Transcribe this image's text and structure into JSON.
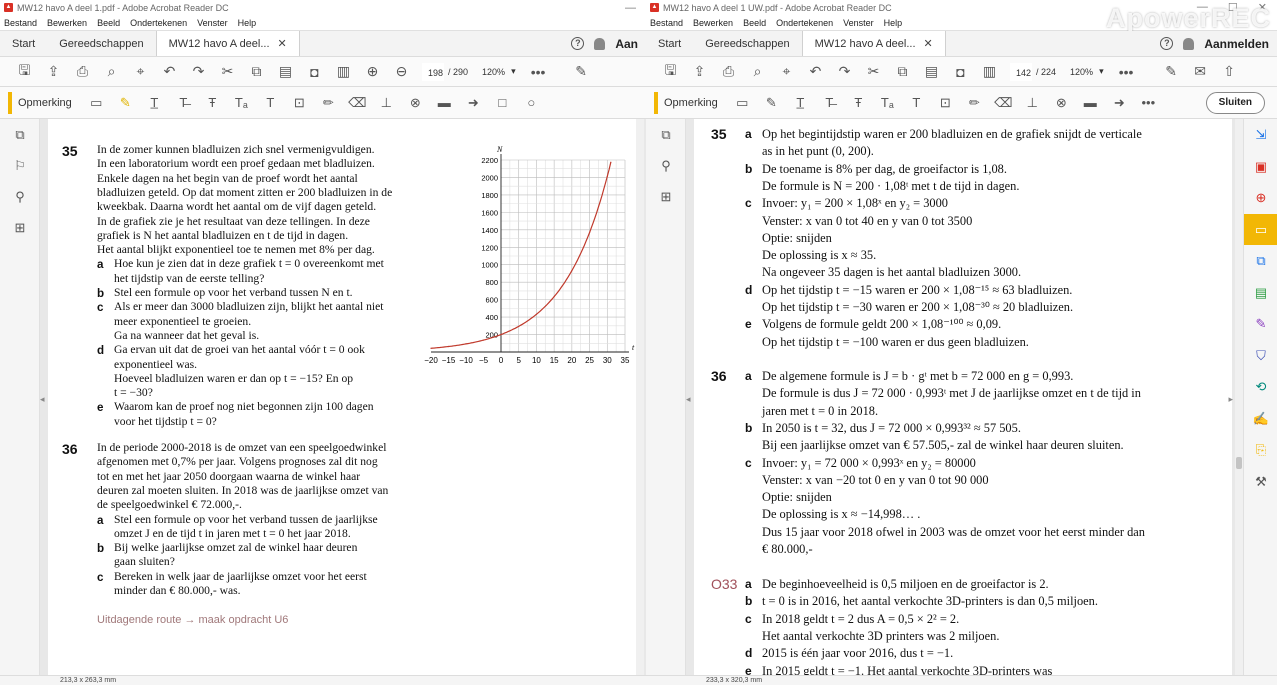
{
  "watermark": "ApowerREC",
  "left_window": {
    "title": "MW12 havo A deel 1.pdf - Adobe Acrobat Reader DC",
    "menu": [
      "Bestand",
      "Bewerken",
      "Beeld",
      "Ondertekenen",
      "Venster",
      "Help"
    ],
    "tabs": [
      "Start",
      "Gereedschappen",
      "MW12 havo A deel..."
    ],
    "signin_partial": "Aan",
    "page_current": "198",
    "page_total": "/ 290",
    "zoom": "120%",
    "comment_label": "Opmerking",
    "status": "213,3 x 263,3 mm",
    "ex35": {
      "num": "35",
      "intro": [
        "In de zomer kunnen bladluizen zich snel vermenigvuldigen.",
        "In een laboratorium wordt een proef gedaan met bladluizen.",
        "Enkele dagen na het begin van de proef wordt het aantal",
        "bladluizen geteld. Op dat moment zitten er 200 bladluizen in de",
        "kweekbak. Daarna wordt het aantal om de vijf dagen geteld.",
        "In de grafiek zie je het resultaat van deze tellingen. In deze",
        "grafiek is N het aantal bladluizen en t de tijd in dagen.",
        "Het aantal blijkt exponentieel toe te nemen met 8% per dag."
      ],
      "items": [
        {
          "label": "a",
          "lines": [
            "Hoe kun je zien dat in deze grafiek t = 0 overeenkomt met",
            "het tijdstip van de eerste telling?"
          ]
        },
        {
          "label": "b",
          "lines": [
            "Stel een formule op voor het verband tussen N en t."
          ]
        },
        {
          "label": "c",
          "lines": [
            "Als er meer dan 3000 bladluizen zijn, blijkt het aantal niet",
            "meer exponentieel te groeien.",
            "Ga na wanneer dat het geval is."
          ]
        },
        {
          "label": "d",
          "lines": [
            "Ga ervan uit dat de groei van het aantal vóór t = 0 ook",
            "exponentieel was.",
            "Hoeveel bladluizen waren er dan op t = −15? En op",
            "t = −30?"
          ]
        },
        {
          "label": "e",
          "lines": [
            "Waarom kan de proef nog niet begonnen zijn 100 dagen",
            "voor het tijdstip t = 0?"
          ]
        }
      ]
    },
    "ex36": {
      "num": "36",
      "intro": [
        "In de periode 2000-2018 is de omzet van een speelgoedwinkel",
        "afgenomen met 0,7% per jaar. Volgens prognoses zal dit nog",
        "tot en met het jaar 2050 doorgaan waarna de winkel haar",
        "deuren zal moeten sluiten. In 2018 was de jaarlijkse omzet van",
        "de speelgoedwinkel € 72.000,-."
      ],
      "items": [
        {
          "label": "a",
          "lines": [
            "Stel een formule op voor het verband tussen de jaarlijkse",
            "omzet J en de tijd t in jaren met t = 0 het jaar 2018."
          ]
        },
        {
          "label": "b",
          "lines": [
            "Bij welke jaarlijkse omzet zal de winkel haar deuren",
            "gaan sluiten?"
          ]
        },
        {
          "label": "c",
          "lines": [
            "Bereken in welk jaar de jaarlijkse omzet voor het eerst",
            "minder dan € 80.000,- was."
          ]
        }
      ]
    },
    "route": "Uitdagende route → maak opdracht U6"
  },
  "chart_data": {
    "type": "line",
    "title": "",
    "xlabel": "t",
    "ylabel": "N",
    "xlim": [
      -20,
      35
    ],
    "ylim": [
      0,
      2200
    ],
    "x_ticks": [
      "−20",
      "−15",
      "−10",
      "−5",
      "0",
      "5",
      "10",
      "15",
      "20",
      "25",
      "30",
      "35"
    ],
    "y_ticks": [
      "200",
      "400",
      "600",
      "800",
      "1000",
      "1200",
      "1400",
      "1600",
      "1800",
      "2000",
      "2200"
    ],
    "grid": true,
    "series": [
      {
        "color": "#c0392b",
        "x": [
          -20,
          -15,
          -10,
          -5,
          0,
          5,
          10,
          15,
          20,
          25,
          30,
          31
        ],
        "y": [
          43,
          63,
          93,
          136,
          200,
          294,
          432,
          634,
          932,
          1370,
          2013,
          2174
        ]
      }
    ]
  },
  "right_window": {
    "title": "MW12 havo A deel 1 UW.pdf - Adobe Acrobat Reader DC",
    "menu": [
      "Bestand",
      "Bewerken",
      "Beeld",
      "Ondertekenen",
      "Venster",
      "Help"
    ],
    "tabs": [
      "Start",
      "Gereedschappen",
      "MW12 havo A deel..."
    ],
    "signin": "Aanmelden",
    "page_current": "142",
    "page_total": "/ 224",
    "zoom": "120%",
    "comment_label": "Opmerking",
    "close_button": "Sluiten",
    "status": "233,3 x 320,3 mm",
    "answers": [
      {
        "num": "35",
        "items": [
          {
            "label": "a",
            "lines": [
              "Op het begintijdstip waren er 200 bladluizen en de grafiek snijdt de verticale",
              "as in het punt (0, 200)."
            ]
          },
          {
            "label": "b",
            "lines": [
              "De toename is 8% per dag, de groeifactor is 1,08.",
              "De formule is N = 200 · 1,08ᵗ met t de tijd in dagen."
            ]
          },
          {
            "label": "c",
            "lines": [
              "Invoer: y₁ = 200 × 1,08ˣ en y₂ = 3000",
              "Venster: x van 0 tot 40 en y van 0 tot 3500",
              "Optie: snijden",
              "De oplossing is x ≈ 35.",
              "Na ongeveer 35 dagen is het aantal bladluizen 3000."
            ]
          },
          {
            "label": "d",
            "lines": [
              "Op het tijdstip t = −15 waren er 200 × 1,08⁻¹⁵ ≈ 63 bladluizen.",
              "Op het tijdstip t = −30 waren er 200 × 1,08⁻³⁰ ≈ 20 bladluizen."
            ]
          },
          {
            "label": "e",
            "lines": [
              "Volgens de formule geldt 200 × 1,08⁻¹⁰⁰ ≈ 0,09.",
              "Op het tijdstip t = −100 waren er dus geen bladluizen."
            ]
          }
        ]
      },
      {
        "num": "36",
        "items": [
          {
            "label": "a",
            "lines": [
              "De algemene formule is J = b · gᵗ met b = 72 000 en g = 0,993.",
              "De formule is dus J = 72 000 · 0,993ᵗ met J de jaarlijkse omzet en t de tijd in",
              "jaren met t = 0 in 2018."
            ]
          },
          {
            "label": "b",
            "lines": [
              "In 2050 is t = 32, dus J = 72 000 × 0,993³² ≈ 57 505.",
              "Bij een jaarlijkse omzet van € 57.505,- zal de winkel haar deuren sluiten."
            ]
          },
          {
            "label": "c",
            "lines": [
              "Invoer: y₁ = 72 000 × 0,993ˣ en y₂ = 80000",
              "Venster: x van −20 tot 0 en y van 0 tot 90 000",
              "Optie: snijden",
              "De oplossing is x ≈ −14,998… .",
              "Dus 15 jaar voor 2018 ofwel in 2003 was de omzet voor het eerst minder dan",
              "€ 80.000,-"
            ]
          }
        ]
      },
      {
        "num": "O33",
        "items": [
          {
            "label": "a",
            "lines": [
              "De beginhoeveelheid is 0,5 miljoen en de groeifactor is 2."
            ]
          },
          {
            "label": "b",
            "lines": [
              "t = 0 is in 2016, het aantal verkochte 3D-printers is dan 0,5 miljoen."
            ]
          },
          {
            "label": "c",
            "lines": [
              "In 2018 geldt t = 2 dus A = 0,5 × 2² = 2.",
              "Het aantal verkochte 3D printers was 2 miljoen."
            ]
          },
          {
            "label": "d",
            "lines": [
              "2015 is één jaar voor 2016, dus t = −1."
            ]
          },
          {
            "label": "e",
            "lines": [
              "In 2015 geldt t = −1. Het aantal verkochte 3D-printers was"
            ]
          }
        ]
      }
    ]
  }
}
